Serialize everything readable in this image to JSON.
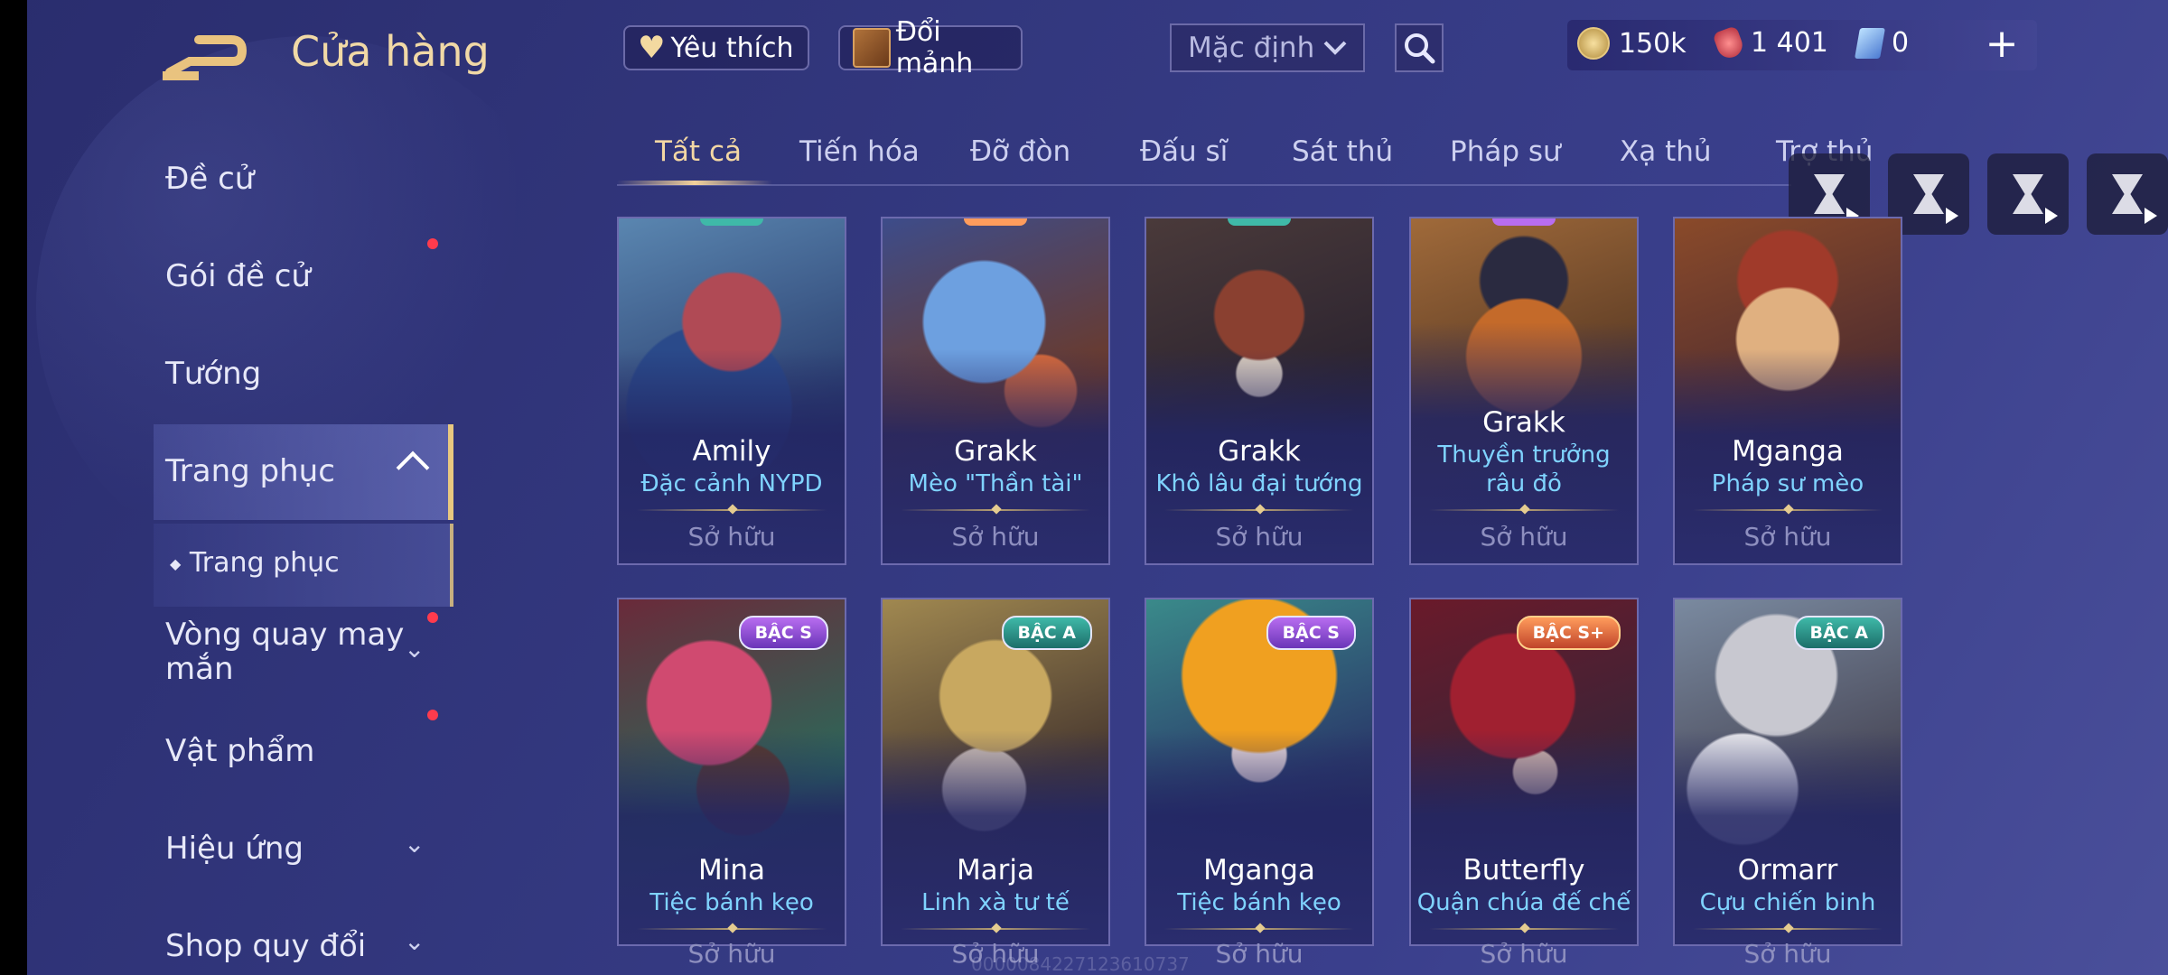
{
  "header": {
    "title": "Cửa hàng",
    "favorites_label": "Yêu thích",
    "fragments_label": "Đổi mảnh",
    "sort_value": "Mặc định",
    "currency": [
      {
        "icon": "gold-coin-icon",
        "value": "150k"
      },
      {
        "icon": "voucher-icon",
        "value": "1 401"
      },
      {
        "icon": "gem-icon",
        "value": "0"
      }
    ]
  },
  "sidebar": {
    "items": [
      {
        "label": "Đề cử"
      },
      {
        "label": "Gói đề cử"
      },
      {
        "label": "Tướng"
      },
      {
        "label": "Trang phục"
      },
      {
        "label": "Trang phục"
      },
      {
        "label": "Vòng quay may mắn"
      },
      {
        "label": "Vật phẩm"
      },
      {
        "label": "Hiệu ứng"
      },
      {
        "label": "Shop quy đổi"
      }
    ]
  },
  "tabs": [
    "Tất cả",
    "Tiến hóa",
    "Đỡ đòn",
    "Đấu sĩ",
    "Sát thủ",
    "Pháp sư",
    "Xạ thủ",
    "Trợ thủ"
  ],
  "cards": [
    {
      "hero": "Amily",
      "skin": "Đặc cảnh NYPD",
      "status": "Sở hữu"
    },
    {
      "hero": "Grakk",
      "skin": "Mèo \"Thần tài\"",
      "status": "Sở hữu"
    },
    {
      "hero": "Grakk",
      "skin": "Khô lâu đại tướng",
      "status": "Sở hữu"
    },
    {
      "hero": "Grakk",
      "skin": "Thuyền trưởng râu đỏ",
      "status": "Sở hữu"
    },
    {
      "hero": "Mganga",
      "skin": "Pháp sư mèo",
      "status": "Sở hữu"
    },
    {
      "hero": "Mina",
      "skin": "Tiệc bánh kẹo",
      "status": "Sở hữu",
      "tier": "BẬC S"
    },
    {
      "hero": "Marja",
      "skin": "Linh xà tư tế",
      "status": "Sở hữu",
      "tier": "BẬC A"
    },
    {
      "hero": "Mganga",
      "skin": "Tiệc bánh kẹo",
      "status": "Sở hữu",
      "tier": "BẬC S"
    },
    {
      "hero": "Butterfly",
      "skin": "Quận chúa đế chế",
      "status": "Sở hữu",
      "tier": "BẬC S+"
    },
    {
      "hero": "Ormarr",
      "skin": "Cựu chiến binh",
      "status": "Sở hữu",
      "tier": "BẬC A"
    }
  ],
  "watermark": "0000084227123610737",
  "colors": {
    "accent_gold": "#f3d7a4",
    "skin_blue": "#7fd3ff",
    "notification_red": "#ff3b4d"
  }
}
